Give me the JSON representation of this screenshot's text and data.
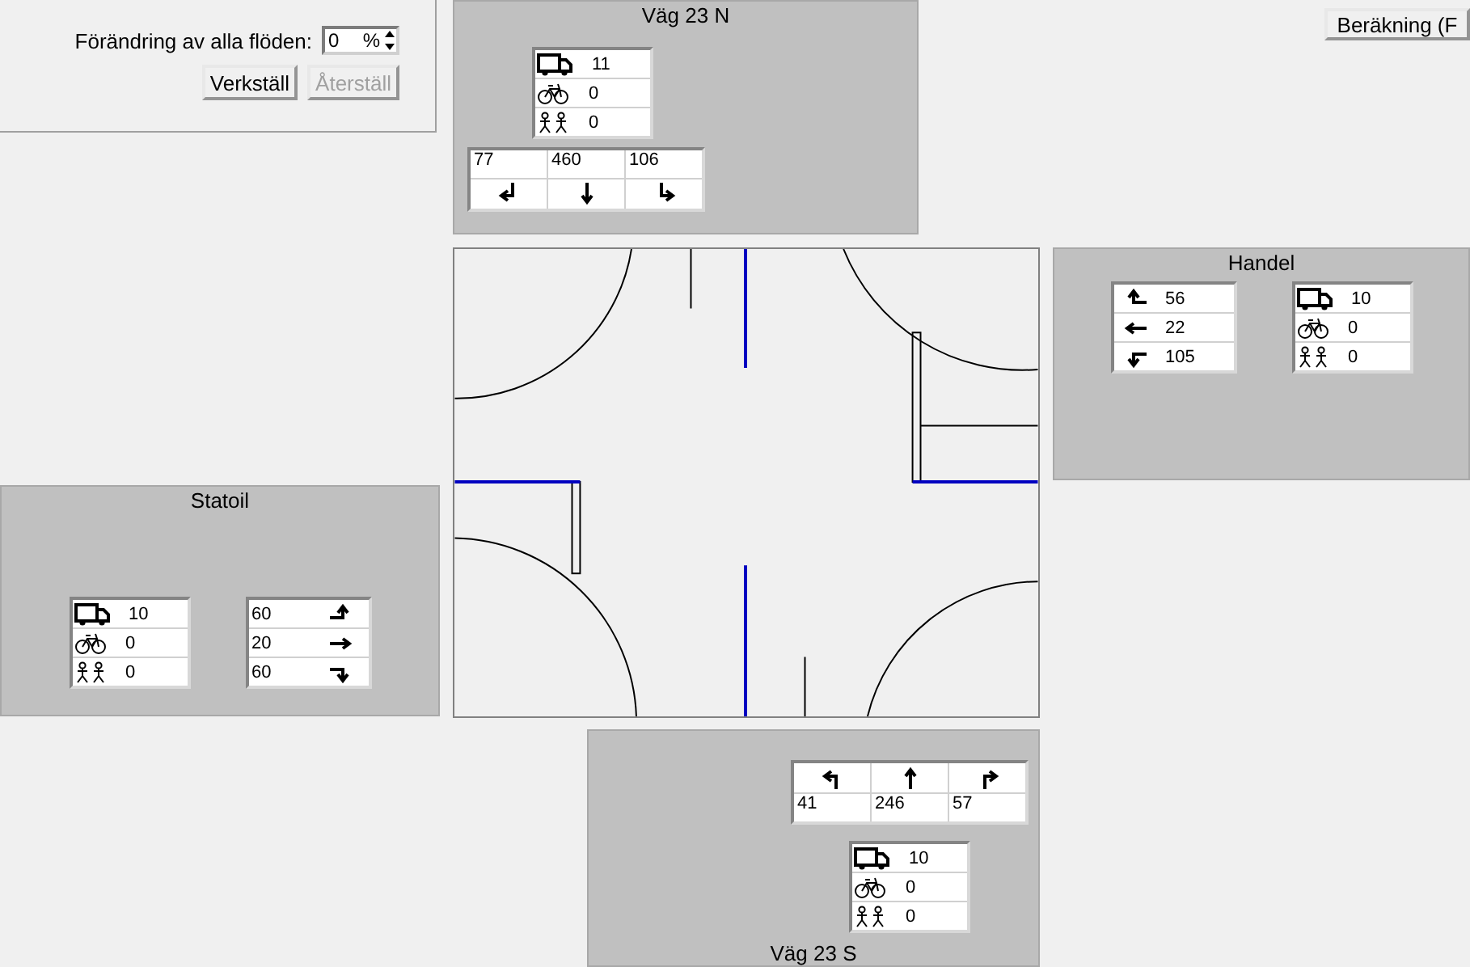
{
  "flow_change": {
    "label": "Förändring av alla flöden:",
    "value": "0",
    "unit": "%"
  },
  "buttons": [
    {
      "label": "Verkställ",
      "disabled": false
    },
    {
      "label": "Återställ",
      "disabled": true
    }
  ],
  "calc_button": {
    "label": "Beräkning (F"
  },
  "approaches": [
    {
      "kind": "north",
      "name": "Väg 23 N",
      "vehicles": [
        {
          "kind": "truck",
          "value": "11"
        },
        {
          "kind": "bicycle",
          "value": "0"
        },
        {
          "kind": "pedestrian",
          "value": "0"
        }
      ],
      "movements": [
        {
          "kind": "right",
          "value": "77"
        },
        {
          "kind": "straight",
          "value": "460"
        },
        {
          "kind": "left",
          "value": "106"
        }
      ]
    },
    {
      "kind": "east",
      "name": "Handel",
      "vehicles": [
        {
          "kind": "truck",
          "value": "10"
        },
        {
          "kind": "bicycle",
          "value": "0"
        },
        {
          "kind": "pedestrian",
          "value": "0"
        }
      ],
      "movements": [
        {
          "kind": "right",
          "value": "56"
        },
        {
          "kind": "straight",
          "value": "22"
        },
        {
          "kind": "left",
          "value": "105"
        }
      ]
    },
    {
      "kind": "west",
      "name": "Statoil",
      "vehicles": [
        {
          "kind": "truck",
          "value": "10"
        },
        {
          "kind": "bicycle",
          "value": "0"
        },
        {
          "kind": "pedestrian",
          "value": "0"
        }
      ],
      "movements": [
        {
          "kind": "left",
          "value": "60"
        },
        {
          "kind": "straight",
          "value": "20"
        },
        {
          "kind": "right",
          "value": "60"
        }
      ]
    },
    {
      "kind": "south",
      "name": "Väg 23 S",
      "vehicles": [
        {
          "kind": "truck",
          "value": "10"
        },
        {
          "kind": "bicycle",
          "value": "0"
        },
        {
          "kind": "pedestrian",
          "value": "0"
        }
      ],
      "movements": [
        {
          "kind": "left",
          "value": "41"
        },
        {
          "kind": "straight",
          "value": "246"
        },
        {
          "kind": "right",
          "value": "57"
        }
      ]
    }
  ]
}
